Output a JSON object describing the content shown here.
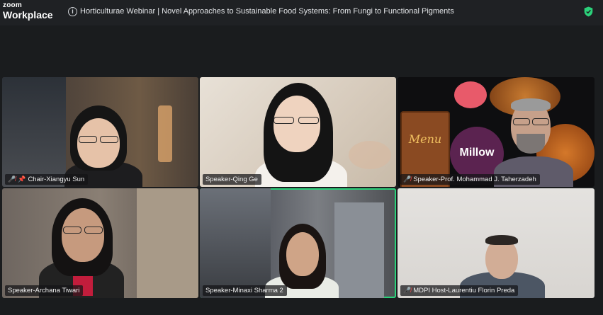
{
  "app": {
    "logo_top": "zoom",
    "logo_bottom": "Workplace",
    "meeting_title": "Horticulturae Webinar | Novel Approaches to Sustainable Food Systems: From Fungi to Functional Pigments"
  },
  "icons": {
    "info": "info-icon",
    "security": "shield-check-icon",
    "muted": "mic-off-icon",
    "pinned": "pin-icon"
  },
  "colors": {
    "active_speaker_border": "#2bd17a",
    "muted_icon": "#ff4b4b",
    "security_shield": "#2bd17a"
  },
  "participants": [
    {
      "name": "Chair-Xiangyu Sun",
      "muted": true,
      "pinned": true
    },
    {
      "name": "Speaker-Qing Ge",
      "muted": false,
      "pinned": false
    },
    {
      "name": "Speaker-Prof. Mohammad J. Taherzadeh",
      "muted": true,
      "pinned": false
    },
    {
      "name": "Speaker-Archana Tiwari",
      "muted": false,
      "pinned": false
    },
    {
      "name": "Speaker-Minaxi Sharma 2",
      "muted": false,
      "pinned": false,
      "active": true
    },
    {
      "name": "MDPI Host-Laurentiu Florin Preda",
      "muted": true,
      "pinned": false
    }
  ],
  "background_art": {
    "menu_sign": "Menu",
    "brand": "Millow"
  }
}
